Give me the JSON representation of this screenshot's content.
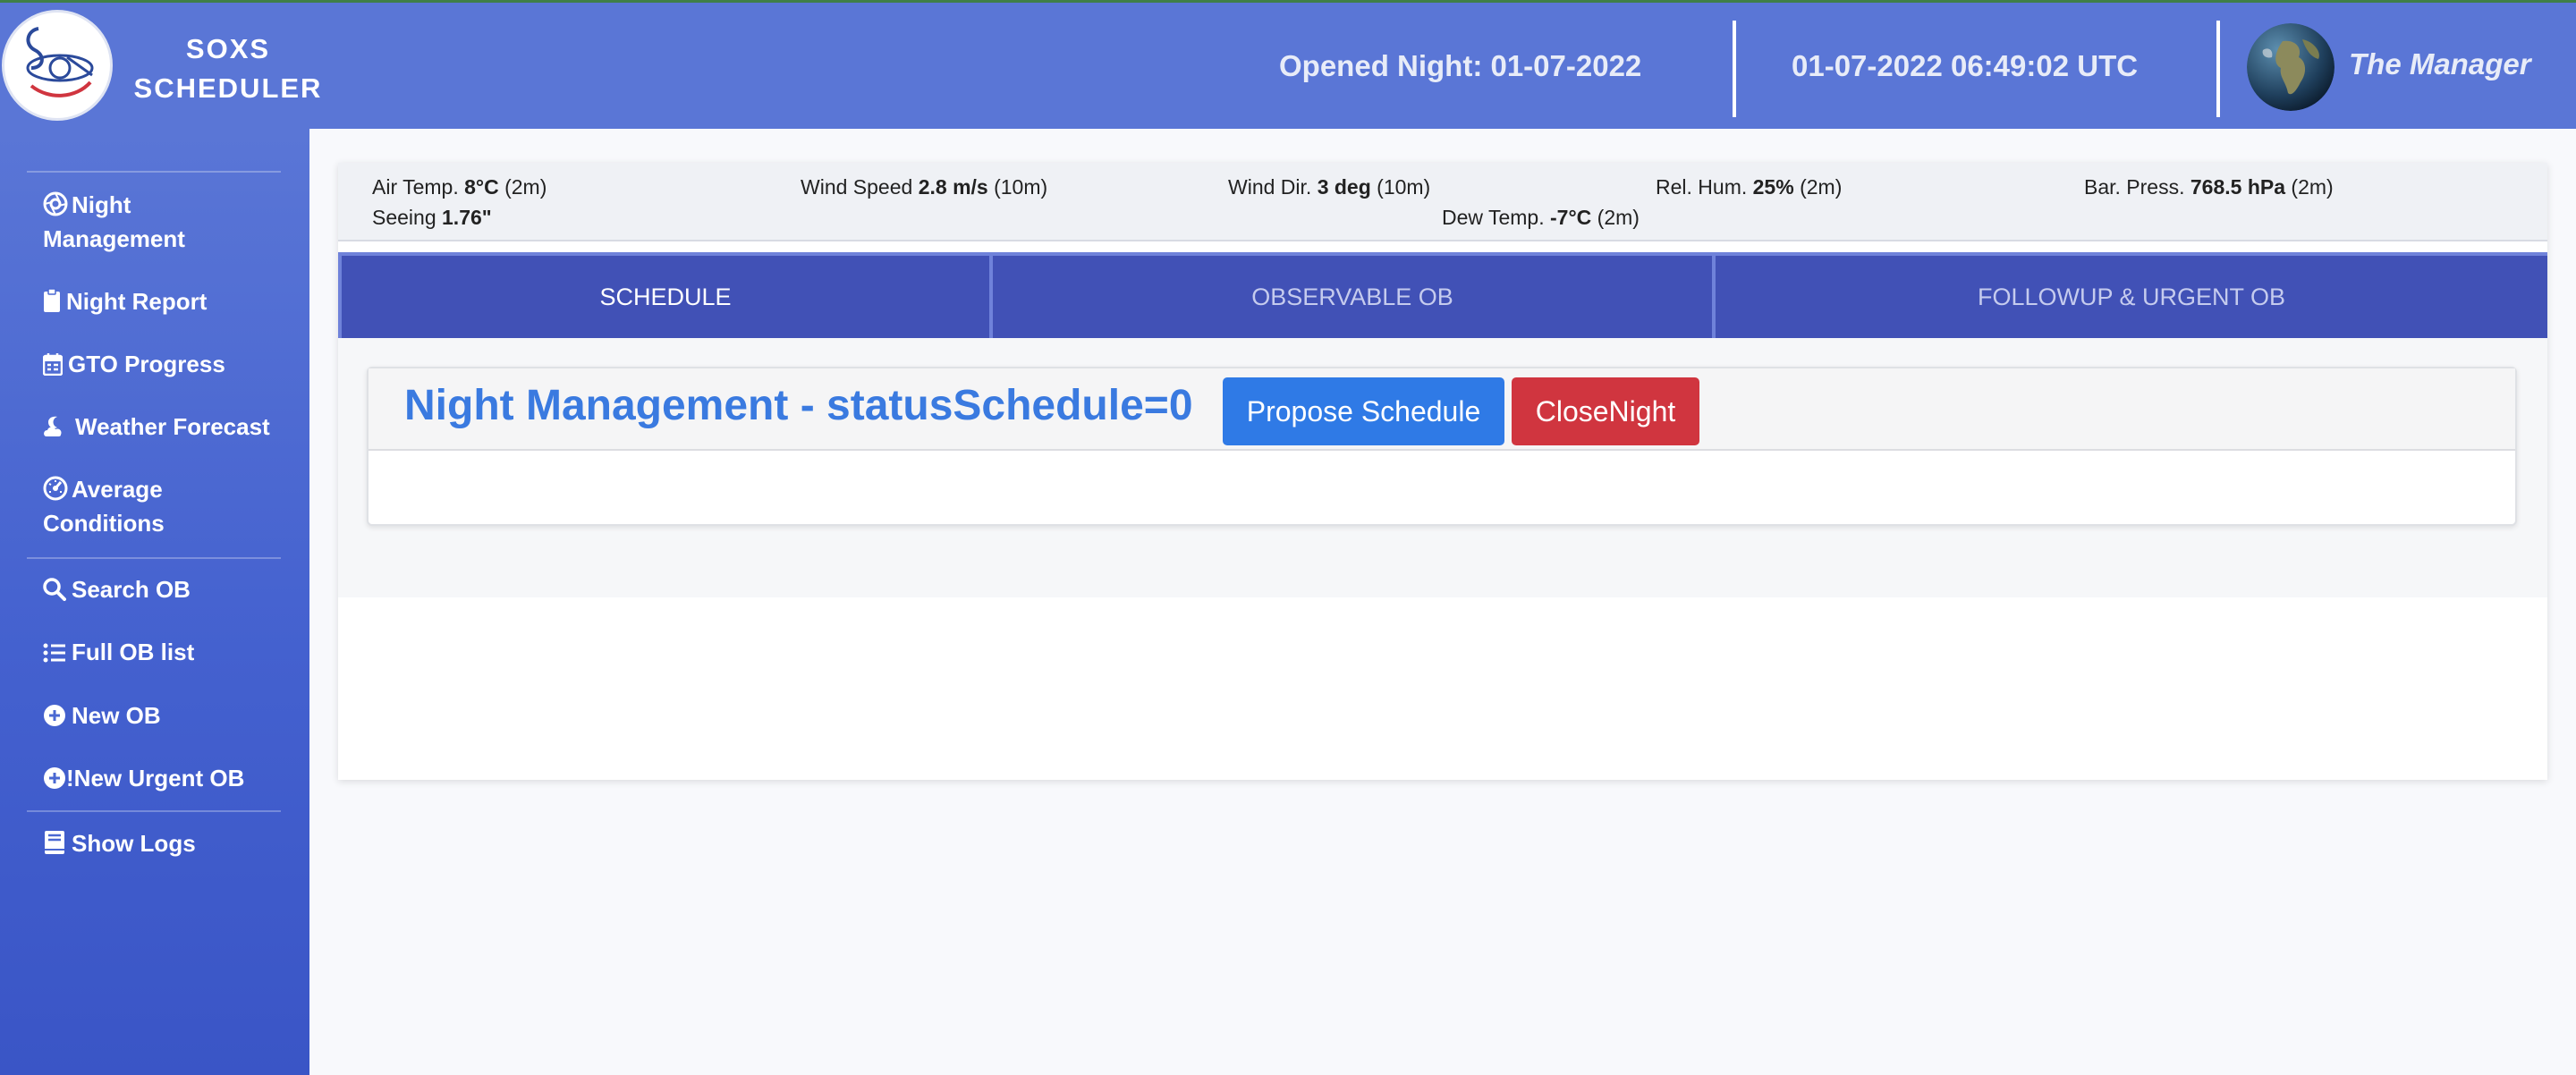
{
  "brand": {
    "line1": "SOXS",
    "line2": "SCHEDULER"
  },
  "header": {
    "opened_night": "Opened Night: 01-07-2022",
    "clock": "01-07-2022 06:49:02 UTC",
    "user": "The Manager"
  },
  "sidebar": {
    "items": [
      {
        "label_1": "Night",
        "label_2": "Management",
        "icon": "aperture-icon"
      },
      {
        "label": "Night Report",
        "icon": "clipboard-icon"
      },
      {
        "label": "GTO Progress",
        "icon": "calendar-icon"
      },
      {
        "label": "Weather Forecast",
        "icon": "cloud-moon-icon"
      },
      {
        "label_1": "Average",
        "label_2": "Conditions",
        "icon": "gauge-icon"
      },
      {
        "label": "Search OB",
        "icon": "search-icon"
      },
      {
        "label": "Full OB list",
        "icon": "list-icon"
      },
      {
        "label": "New OB",
        "icon": "plus-circle-icon"
      },
      {
        "label": "New Urgent OB",
        "icon": "plus-circle-icon"
      },
      {
        "label": "Show Logs",
        "icon": "book-icon"
      }
    ]
  },
  "weather": {
    "air_temp": {
      "label": "Air Temp.",
      "value": "8°C",
      "suffix": "(2m)"
    },
    "wind_speed": {
      "label": "Wind Speed",
      "value": "2.8 m/s",
      "suffix": "(10m)"
    },
    "wind_dir": {
      "label": "Wind Dir.",
      "value": "3 deg",
      "suffix": "(10m)"
    },
    "rel_hum": {
      "label": "Rel. Hum.",
      "value": "25%",
      "suffix": "(2m)"
    },
    "bar_press": {
      "label": "Bar. Press.",
      "value": "768.5 hPa",
      "suffix": "(2m)"
    },
    "seeing": {
      "label": "Seeing",
      "value": "1.76\""
    },
    "dew_temp": {
      "label": "Dew Temp.",
      "value": "-7°C",
      "suffix": "(2m)"
    }
  },
  "tabs": [
    {
      "label": "SCHEDULE"
    },
    {
      "label": "OBSERVABLE OB"
    },
    {
      "label": "FOLLOWUP & URGENT OB"
    }
  ],
  "card": {
    "title": "Night Management - statusSchedule=0",
    "propose_label": "Propose Schedule",
    "close_label": "CloseNight"
  },
  "colors": {
    "header": "#5a76d6",
    "sidebar": "#4461cf",
    "tab": "#4151b6",
    "title": "#3a7ae0",
    "primary_button": "#2f7ae6",
    "danger_button": "#d0353f"
  }
}
